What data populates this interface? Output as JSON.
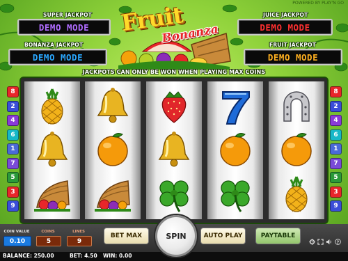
{
  "header": {
    "powered_by": "POWERED BY PLAY'N GO",
    "logo_line1": "Fruit",
    "logo_line2": "Bonanza",
    "notice": "JACKPOTS CAN ONLY BE WON WHEN PLAYING MAX COINS"
  },
  "jackpots": {
    "super": {
      "label": "SUPER JACKPOT",
      "value": "DEMO MODE",
      "color": "#b06cff"
    },
    "bonanza": {
      "label": "BONANZA JACKPOT",
      "value": "DEMO MODE",
      "color": "#2aa8ff"
    },
    "juice": {
      "label": "JUICE JACKPOT",
      "value": "DEMO MODE",
      "color": "#ff3030"
    },
    "fruit": {
      "label": "FRUIT JACKPOT",
      "value": "DEMO MODE",
      "color": "#ffb020"
    }
  },
  "reels": [
    [
      "pineapple",
      "bell",
      "cornucopia"
    ],
    [
      "bell",
      "orange",
      "cornucopia"
    ],
    [
      "strawberry",
      "bell",
      "clover"
    ],
    [
      "seven",
      "orange",
      "clover"
    ],
    [
      "horseshoe",
      "orange",
      "pineapple"
    ]
  ],
  "paylines": {
    "left": [
      {
        "n": "8",
        "color": "#e8262a"
      },
      {
        "n": "2",
        "color": "#3a4ed8"
      },
      {
        "n": "4",
        "color": "#8a3ad8"
      },
      {
        "n": "6",
        "color": "#17b8c8"
      },
      {
        "n": "1",
        "color": "#4a6ad8"
      },
      {
        "n": "7",
        "color": "#7a4ad8"
      },
      {
        "n": "5",
        "color": "#2a9a3a"
      },
      {
        "n": "3",
        "color": "#e8262a"
      },
      {
        "n": "9",
        "color": "#3a4ed8"
      }
    ],
    "right": [
      {
        "n": "8",
        "color": "#e8262a"
      },
      {
        "n": "2",
        "color": "#3a4ed8"
      },
      {
        "n": "4",
        "color": "#8a3ad8"
      },
      {
        "n": "6",
        "color": "#17b8c8"
      },
      {
        "n": "1",
        "color": "#4a6ad8"
      },
      {
        "n": "7",
        "color": "#7a4ad8"
      },
      {
        "n": "5",
        "color": "#2a9a3a"
      },
      {
        "n": "3",
        "color": "#e8262a"
      },
      {
        "n": "9",
        "color": "#3a4ed8"
      }
    ]
  },
  "controls": {
    "coin_value_label": "COIN VALUE",
    "coin_value": "0.10",
    "coins_label": "COINS",
    "coins": "5",
    "lines_label": "LINES",
    "lines": "9",
    "bet_max": "BET MAX",
    "spin": "SPIN",
    "auto_play": "AUTO PLAY",
    "paytable": "PAYTABLE"
  },
  "status": {
    "balance": "BALANCE: 250.00",
    "bet": "BET: 4.50",
    "win": "WIN: 0.00"
  },
  "system_icons": [
    "gear-icon",
    "fullscreen-icon",
    "sound-icon",
    "help-icon"
  ]
}
